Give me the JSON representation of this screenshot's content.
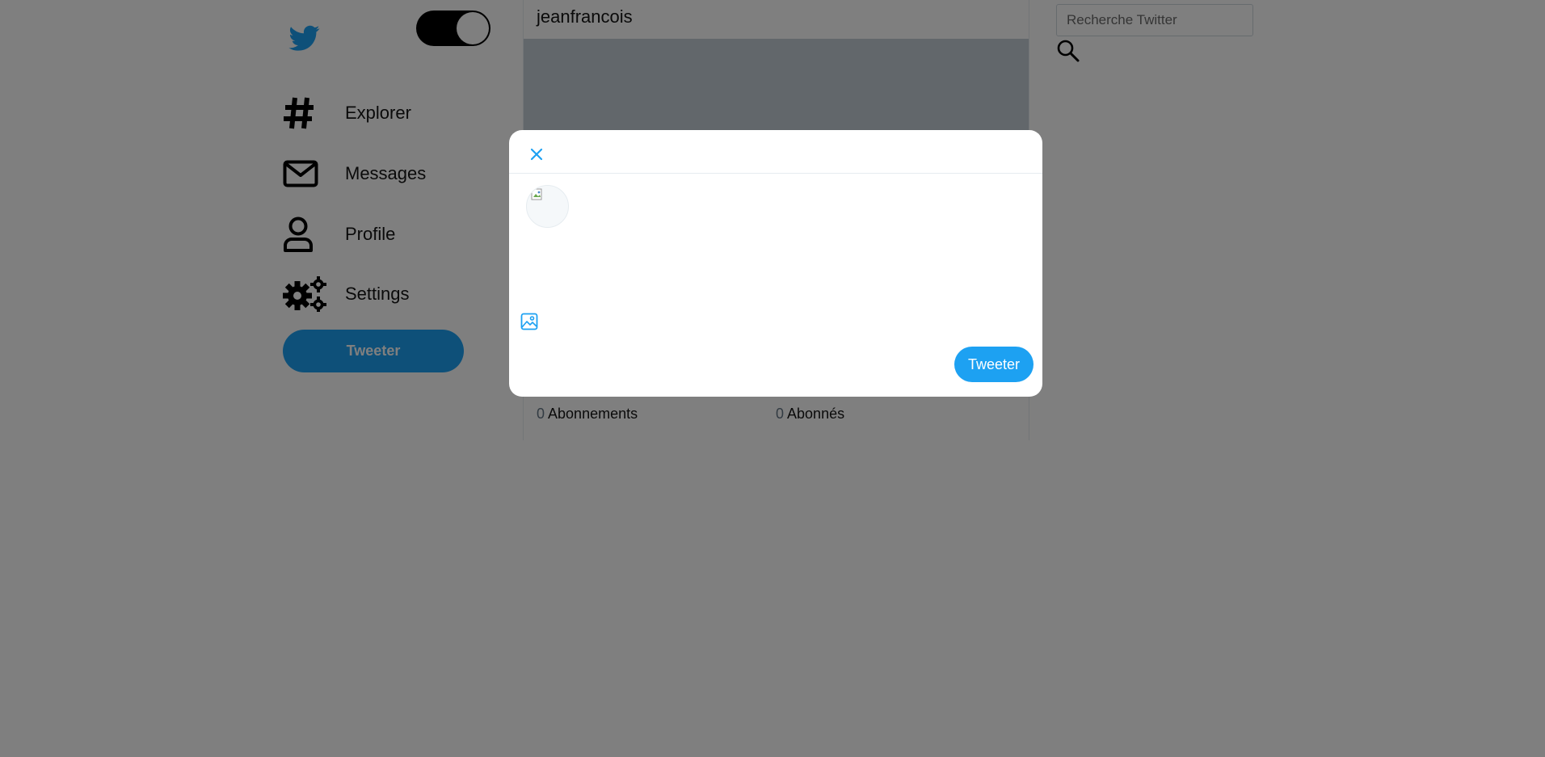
{
  "sidebar": {
    "logo_icon": "twitter-bird-icon",
    "theme_toggle_icon": "sun-icon",
    "items": [
      {
        "label": "Explorer",
        "icon": "hashtag-icon"
      },
      {
        "label": "Messages",
        "icon": "envelope-icon"
      },
      {
        "label": "Profile",
        "icon": "user-icon"
      },
      {
        "label": "Settings",
        "icon": "gears-icon"
      }
    ],
    "tweet_button_label": "Tweeter"
  },
  "main": {
    "username": "jeanfrancois",
    "following_count": "0",
    "following_label": "Abonnements",
    "followers_count": "0",
    "followers_label": "Abonnés"
  },
  "search": {
    "placeholder": "Recherche Twitter",
    "icon": "search-icon"
  },
  "modal": {
    "close_icon": "close-icon",
    "avatar": "avatar",
    "textarea_value": "",
    "image_icon": "image-icon",
    "submit_label": "Tweeter"
  },
  "colors": {
    "accent": "#1da1f2",
    "overlay": "rgba(0,0,0,0.5)",
    "text": "#141414"
  }
}
